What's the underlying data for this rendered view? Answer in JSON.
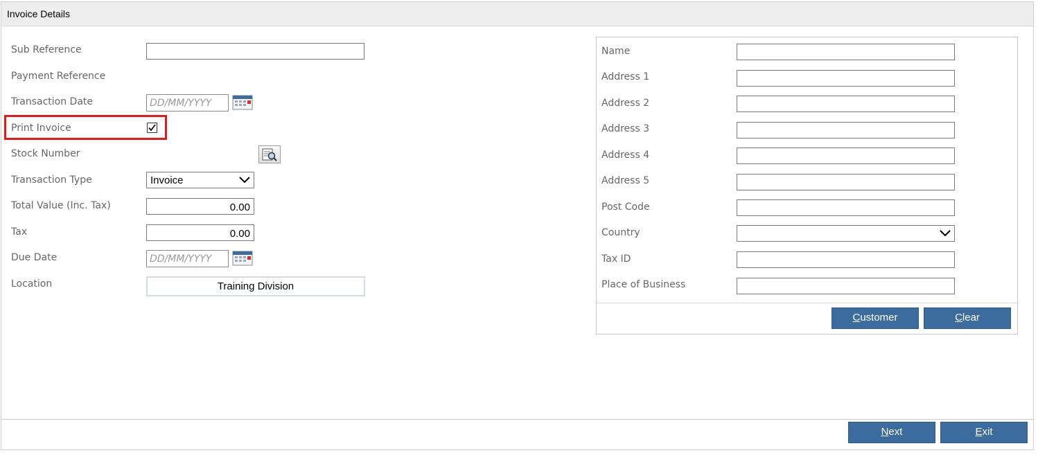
{
  "header": {
    "title": "Invoice Details"
  },
  "form": {
    "sub_reference": {
      "label": "Sub Reference",
      "value": ""
    },
    "payment_reference": {
      "label": "Payment Reference"
    },
    "transaction_date": {
      "label": "Transaction Date",
      "placeholder": "DD/MM/YYYY"
    },
    "print_invoice": {
      "label": "Print Invoice",
      "checked": true
    },
    "stock_number": {
      "label": "Stock Number"
    },
    "transaction_type": {
      "label": "Transaction Type",
      "value": "Invoice"
    },
    "total_value": {
      "label": "Total Value (Inc. Tax)",
      "value": "0.00"
    },
    "tax": {
      "label": "Tax",
      "value": "0.00"
    },
    "due_date": {
      "label": "Due Date",
      "placeholder": "DD/MM/YYYY"
    },
    "location": {
      "label": "Location",
      "value": "Training Division"
    }
  },
  "customer": {
    "fields": [
      {
        "label": "Name",
        "value": ""
      },
      {
        "label": "Address 1",
        "value": ""
      },
      {
        "label": "Address 2",
        "value": ""
      },
      {
        "label": "Address 3",
        "value": ""
      },
      {
        "label": "Address 4",
        "value": ""
      },
      {
        "label": "Address 5",
        "value": ""
      },
      {
        "label": "Post Code",
        "value": ""
      },
      {
        "label": "Country",
        "value": ""
      },
      {
        "label": "Tax ID",
        "value": ""
      },
      {
        "label": "Place of Business",
        "value": ""
      }
    ],
    "customer_button": {
      "first": "C",
      "rest": "ustomer"
    },
    "clear_button": {
      "first": "C",
      "rest": "lear"
    }
  },
  "footer": {
    "next_button": {
      "first": "N",
      "rest": "ext"
    },
    "exit_button": {
      "first": "E",
      "rest": "xit"
    }
  },
  "colors": {
    "button": "#3c6b9e",
    "highlight": "#e81818"
  },
  "icons": [
    "calendar-icon",
    "lookup-icon",
    "chevron-down-icon",
    "checkmark-icon"
  ]
}
